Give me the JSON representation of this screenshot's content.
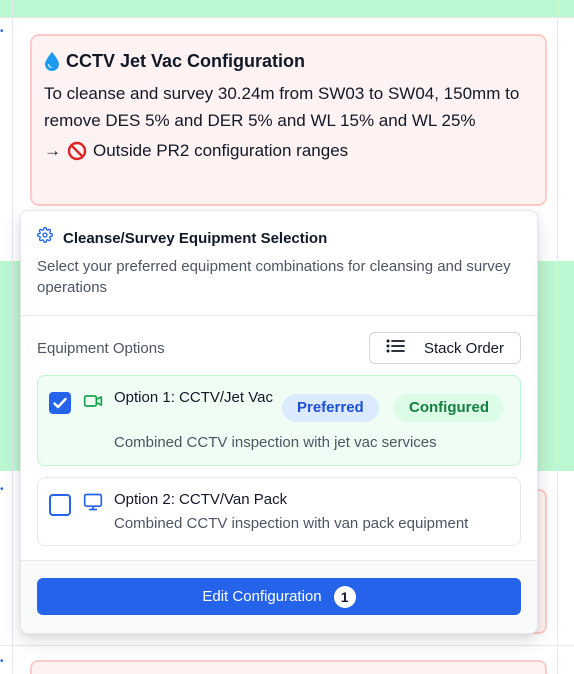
{
  "colors": {
    "accent": "#2563eb",
    "row_green": "#bbf7d0",
    "card_red_bg": "#fef2f2",
    "card_red_border": "#fecaca",
    "preferred_badge": "#dbeafe",
    "configured_badge": "#dcfce7"
  },
  "config_card": {
    "icon": "droplet-icon",
    "title": "CCTV Jet Vac Configuration",
    "description": "To cleanse and survey 30.24m from SW03 to SW04, 150mm to remove DES 5% and DER 5% and WL 15% and WL 25%",
    "status_arrow": "→",
    "status_icon": "prohibited-icon",
    "status_text": "Outside PR2 configuration ranges"
  },
  "panel": {
    "title_icon": "gear-icon",
    "title": "Cleanse/Survey Equipment Selection",
    "subtitle": "Select your preferred equipment combinations for cleansing and survey operations",
    "options_label": "Equipment Options",
    "stack_order_icon": "list-icon",
    "stack_order_label": "Stack Order",
    "options": [
      {
        "checked": true,
        "icon": "video-camera-icon",
        "name": "Option 1: CCTV/Jet Vac",
        "description": "Combined CCTV inspection with jet vac services",
        "badges": [
          "Preferred",
          "Configured"
        ]
      },
      {
        "checked": false,
        "icon": "monitor-icon",
        "name": "Option 2: CCTV/Van Pack",
        "description": "Combined CCTV inspection with van pack equipment",
        "badges": []
      }
    ],
    "edit_button_label": "Edit Configuration",
    "edit_button_count": "1"
  }
}
